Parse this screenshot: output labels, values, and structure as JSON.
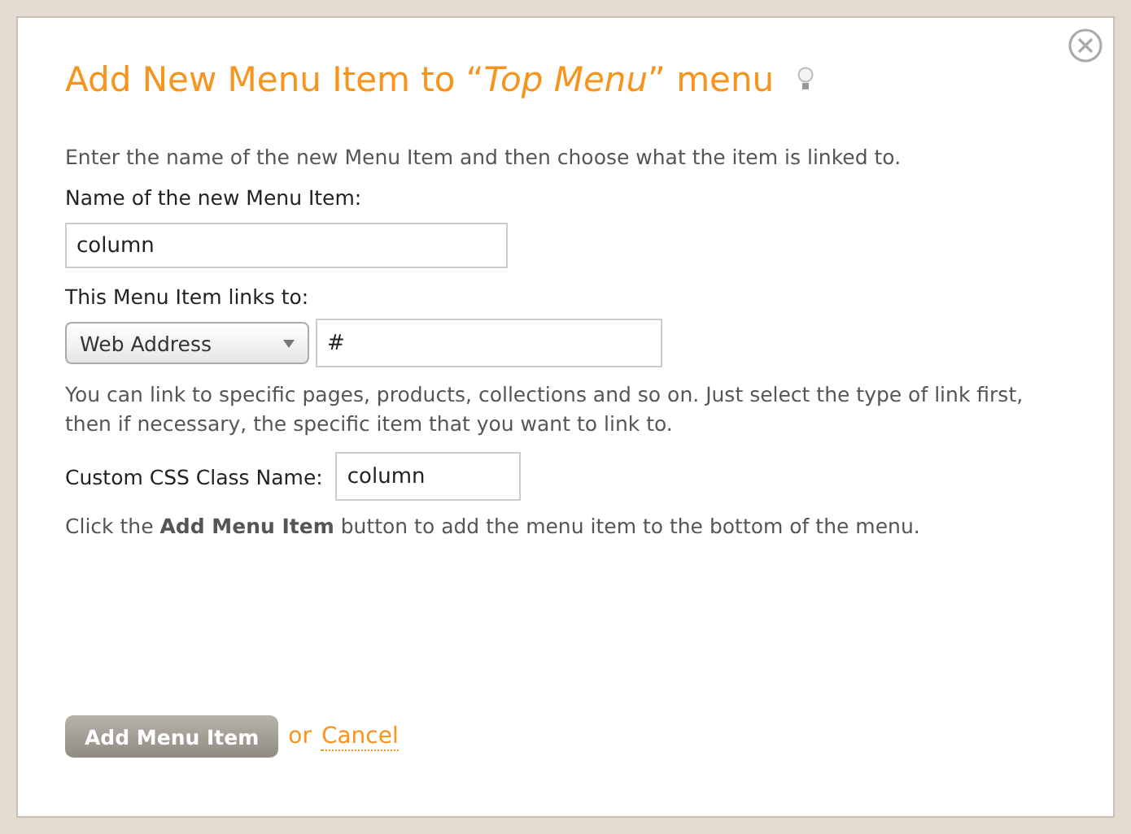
{
  "dialog": {
    "title": "Add New Menu Item to “*Top Menu*” menu",
    "intro": "Enter the name of the new Menu Item and then choose what the item is linked to.",
    "name_field": {
      "label": "Name of the new Menu Item:",
      "value": "column"
    },
    "link_field": {
      "label": "This Menu Item links to:",
      "type_value": "Web Address",
      "value": "#"
    },
    "link_help": "You can link to specific pages, products, collections and so on. Just select the type of link first, then if necessary, the specific item that you want to link to.",
    "css_field": {
      "label": "Custom CSS Class Name:",
      "value": "column"
    },
    "hint": "Click the **Add Menu Item** button to add the menu item to the bottom of the menu.",
    "submit_button": "Add Menu Item",
    "or_text": "or",
    "cancel_link": "Cancel"
  }
}
